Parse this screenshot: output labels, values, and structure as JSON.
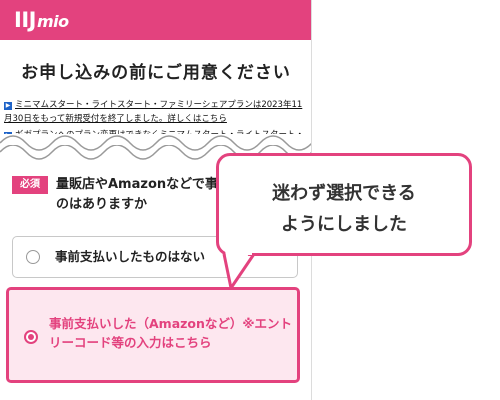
{
  "header": {
    "logo_main": "IIJ",
    "logo_sub": "mio",
    "color": "#e3427e"
  },
  "page": {
    "title": "お申し込みの前にご用意ください"
  },
  "notices": [
    {
      "icon": "arrow-right-icon",
      "text": "ミニマムスタート・ライトスタート・ファミリーシェアプランは2023年11月30日をもって新規受付を終了しました。詳しくはこちら"
    },
    {
      "icon": "arrow-right-icon",
      "text": "ギガプランへのプラン変更はできなくミニマムスタート・ライトスタート・ファミリーシェアプランの契約中"
    }
  ],
  "question": {
    "required_label": "必須",
    "text": "量販店やAmazonなどで事前支払いされたものはありますか"
  },
  "options": [
    {
      "label": "事前支払いしたものはない",
      "selected": false
    },
    {
      "label": "事前支払いした（Amazonなど）※エントリーコード等の入力はこちら",
      "selected": true
    }
  ],
  "callout": {
    "line1": "迷わず選択できる",
    "line2": "ようにしました"
  }
}
